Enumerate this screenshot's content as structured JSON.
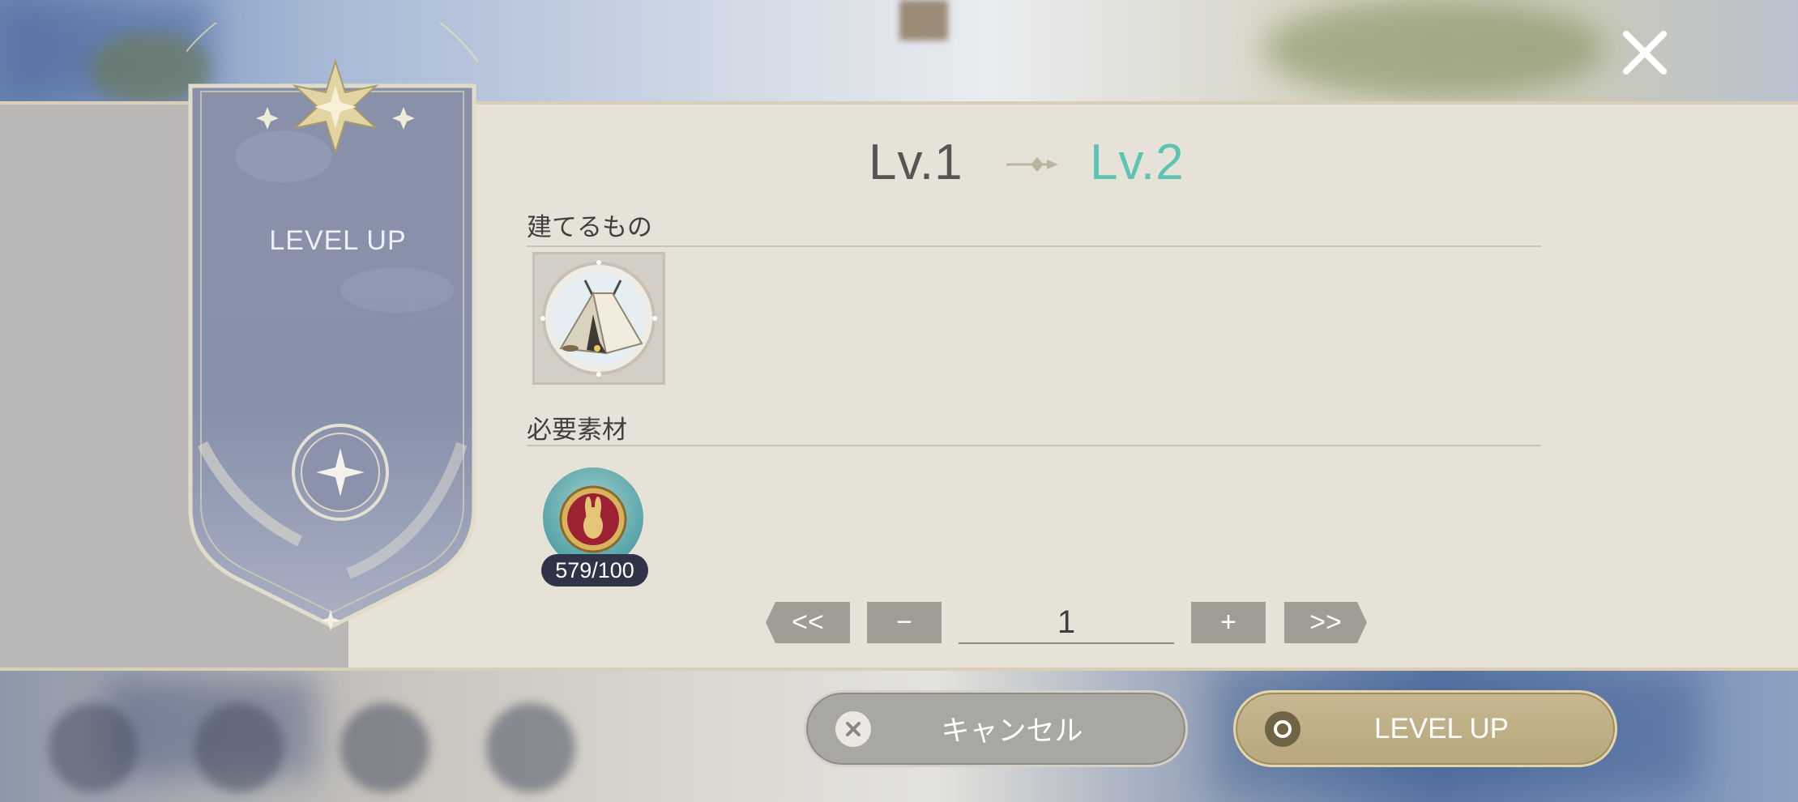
{
  "dialog": {
    "banner_title": "LEVEL UP",
    "level_from": "Lv.1",
    "level_to": "Lv.2",
    "sections": {
      "build_label": "建てるもの",
      "materials_label": "必要素材"
    },
    "build_item": {
      "icon": "tent-icon"
    },
    "material": {
      "icon": "rabbit-medallion-icon",
      "count": "579/100"
    },
    "quantity": {
      "min_label": "<<",
      "dec_label": "−",
      "value": "1",
      "inc_label": "+",
      "max_label": ">>"
    },
    "buttons": {
      "cancel_label": "キャンセル",
      "levelup_label": "LEVEL UP"
    }
  },
  "colors": {
    "panel": "#e7e2d8",
    "level_to": "#5cc3b5",
    "banner": "#8b93ad",
    "button_gold": "#b8a77c"
  }
}
